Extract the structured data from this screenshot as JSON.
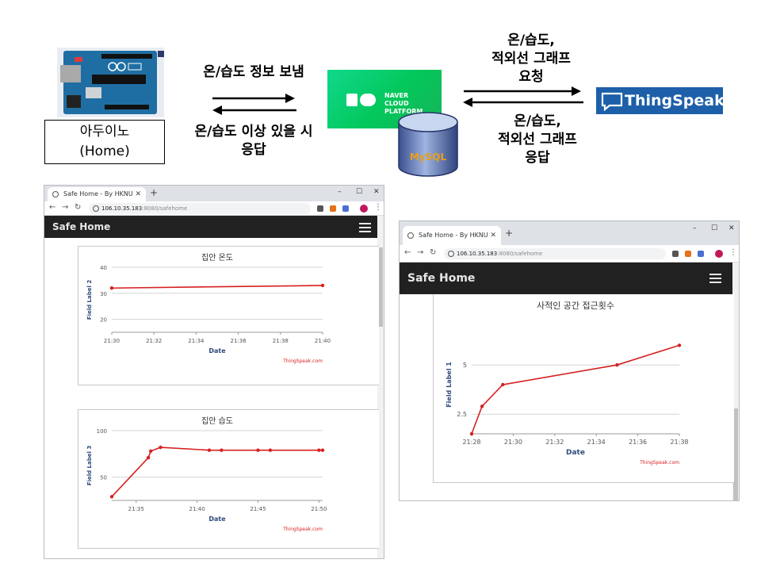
{
  "arduino": {
    "label_line1": "아두이노",
    "label_line2": "(Home)"
  },
  "flows": {
    "send_label": "온/습도 정보 보냄",
    "reply_label_line1": "온/습도 이상 있을 시",
    "reply_label_line2": "응답",
    "request_label_line1": "온/습도,",
    "request_label_line2": "적외선 그래프",
    "request_label_line3": "요청",
    "response_label_line1": "온/습도,",
    "response_label_line2": "적외선 그래프",
    "response_label_line3": "응답"
  },
  "naver": {
    "line1": "NAVER",
    "line2": "CLOUD PLATFORM"
  },
  "mysql": {
    "label": "MySQL"
  },
  "thingspeak": {
    "logo_text": "ThingSpeak"
  },
  "browser": {
    "tab_title": "Safe Home - By HKNU",
    "url_host": "106.10.35.183",
    "url_path": ":8080/safehome",
    "app_title": "Safe Home"
  },
  "chart_data": [
    {
      "type": "line",
      "title": "집안 온도",
      "xlabel": "Date",
      "ylabel": "Field Label 2",
      "x": [
        "21:30",
        "21:40"
      ],
      "values": [
        32,
        33
      ],
      "xticks": [
        "21:30",
        "21:32",
        "21:34",
        "21:36",
        "21:38",
        "21:40"
      ],
      "yticks": [
        20,
        30,
        40
      ],
      "ylim": [
        15,
        40
      ],
      "credit": "ThingSpeak.com",
      "color": "#d62020"
    },
    {
      "type": "line",
      "title": "집안 습도",
      "xlabel": "Date",
      "ylabel": "Field Label 3",
      "x": [
        "21:33",
        "21:36",
        "21:36.2",
        "21:37",
        "21:41",
        "21:42",
        "21:45",
        "21:46",
        "21:50",
        "21:50.3"
      ],
      "values": [
        29,
        71,
        78,
        82,
        79,
        79,
        79,
        79,
        79,
        79
      ],
      "xticks": [
        "21:35",
        "21:40",
        "21:45",
        "21:50"
      ],
      "yticks": [
        50,
        100
      ],
      "ylim": [
        25,
        100
      ],
      "credit": "ThingSpeak.com",
      "color": "#d62020"
    },
    {
      "type": "line",
      "title": "사적인 공간 접근횟수",
      "xlabel": "Date",
      "ylabel": "Field Label 1",
      "x": [
        "21:28",
        "21:28.5",
        "21:29.5",
        "21:35",
        "21:38"
      ],
      "values": [
        1.5,
        2.9,
        4.0,
        5.0,
        6.0
      ],
      "xticks": [
        "21:28",
        "21:30",
        "21:32",
        "21:34",
        "21:36",
        "21:38"
      ],
      "yticks": [
        2.5,
        5
      ],
      "ylim": [
        1.5,
        6.5
      ],
      "credit": "ThingSpeak.com",
      "color": "#d62020"
    }
  ]
}
